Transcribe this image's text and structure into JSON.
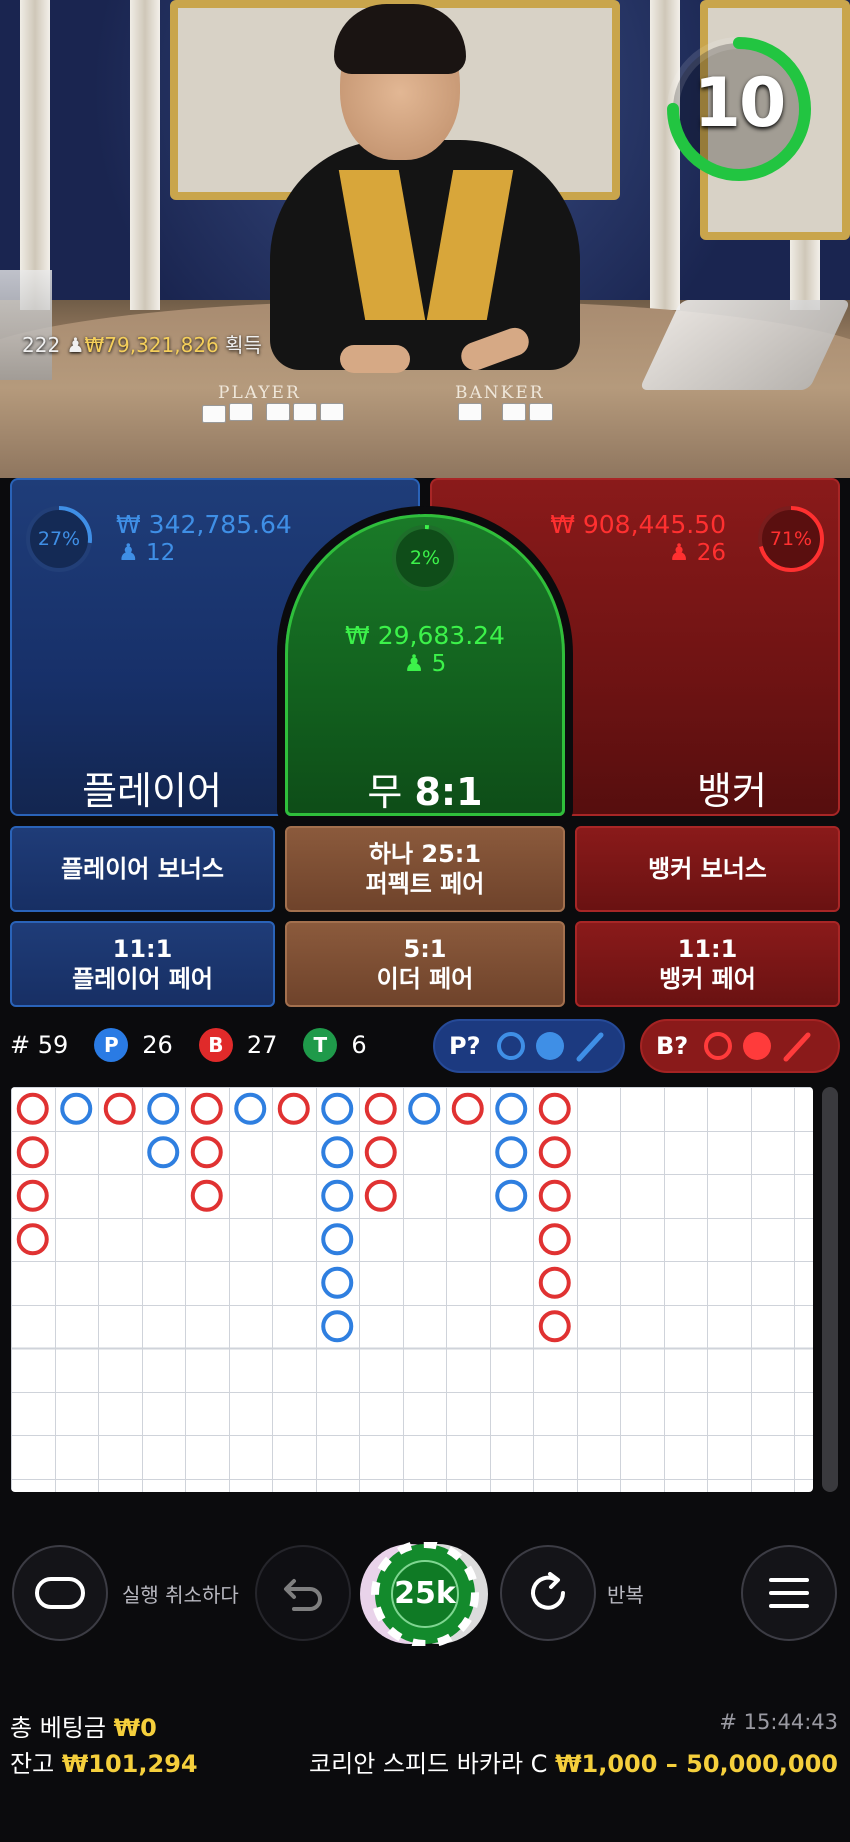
{
  "video": {
    "table_player_label": "PLAYER",
    "table_banker_label": "BANKER",
    "winners_count": "222",
    "winners_amount": "₩79,321,826",
    "winners_suffix": "획득",
    "timer_value": "10",
    "timer_fraction": 0.75,
    "timer_color": "#22c541"
  },
  "bets": {
    "player": {
      "percent": "27%",
      "percent_value": 0.27,
      "amount": "₩ 342,785.64",
      "players": "12",
      "label": "플레이어",
      "color": "#3f8fe6"
    },
    "tie": {
      "percent": "2%",
      "percent_value": 0.02,
      "amount": "₩ 29,683.24",
      "players": "5",
      "label_prefix": "무",
      "label_odds": "8:1",
      "color": "#3cf24a"
    },
    "banker": {
      "percent": "71%",
      "percent_value": 0.71,
      "amount": "₩ 908,445.50",
      "players": "26",
      "label": "뱅커",
      "color": "#ff3030"
    }
  },
  "side_bets": {
    "player_bonus": "플레이어 보너스",
    "perfect_pair_line1": "하나 25:1",
    "perfect_pair_line2": "퍼펙트 페어",
    "banker_bonus": "뱅커 보너스",
    "player_pair_line1": "11:1",
    "player_pair_line2": "플레이어 페어",
    "either_pair_line1": "5:1",
    "either_pair_line2": "이더 페어",
    "banker_pair_line1": "11:1",
    "banker_pair_line2": "뱅커 페어"
  },
  "stats": {
    "round_label": "# 59",
    "player_badge": "P",
    "player_count": "26",
    "banker_badge": "B",
    "banker_count": "27",
    "tie_badge": "T",
    "tie_count": "6",
    "predict_player": "P?",
    "predict_banker": "B?"
  },
  "roadmap": {
    "big_road": [
      {
        "col": 0,
        "results": [
          "B",
          "B",
          "B",
          "B"
        ]
      },
      {
        "col": 1,
        "results": [
          "P"
        ]
      },
      {
        "col": 2,
        "results": [
          "B"
        ]
      },
      {
        "col": 3,
        "results": [
          "P",
          "P"
        ]
      },
      {
        "col": 4,
        "results": [
          "B",
          "B",
          "B"
        ]
      },
      {
        "col": 5,
        "results": [
          "P"
        ]
      },
      {
        "col": 6,
        "results": [
          "B"
        ]
      },
      {
        "col": 7,
        "results": [
          "P",
          "P",
          "P",
          "P",
          "P",
          "P"
        ]
      },
      {
        "col": 8,
        "results": [
          "B",
          "B",
          "B"
        ]
      },
      {
        "col": 9,
        "results": [
          "P"
        ]
      },
      {
        "col": 10,
        "results": [
          "B"
        ]
      },
      {
        "col": 11,
        "results": [
          "P",
          "P",
          "P"
        ]
      },
      {
        "col": 12,
        "results": [
          "B",
          "B",
          "B",
          "B",
          "B",
          "B"
        ]
      }
    ]
  },
  "controls": {
    "undo_label": "실행 취소하다",
    "chip_value": "25k",
    "repeat_label": "반복"
  },
  "footer": {
    "total_bet_label": "총 베팅금",
    "total_bet_value": "₩0",
    "balance_label": "잔고",
    "balance_value": "₩101,294",
    "game_id": "# 15:44:43",
    "table_name": "코리안 스피드 바카라 C",
    "limits": "₩1,000 – 50,000,000"
  }
}
